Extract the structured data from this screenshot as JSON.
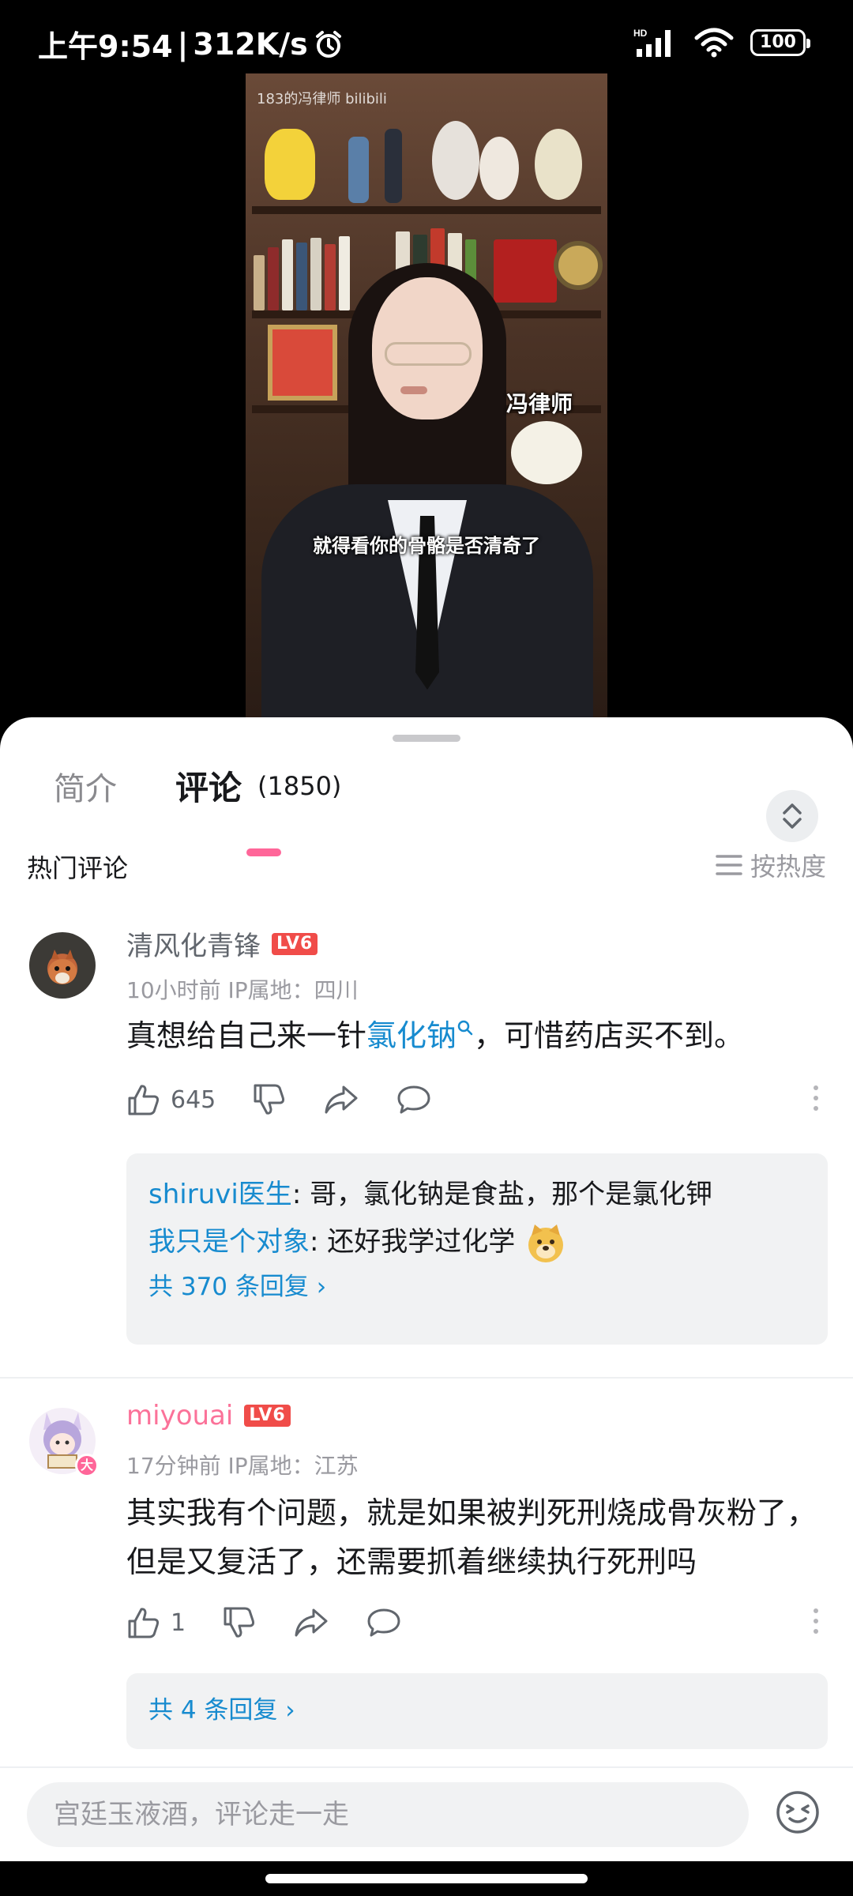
{
  "status_bar": {
    "time": "上午9:54",
    "speed": "312K/s",
    "network": "HD",
    "battery": "100"
  },
  "video": {
    "watermark": "183的冯律师 bilibili",
    "name_caption": "冯律师",
    "subtitle": "就得看你的骨骼是否清奇了"
  },
  "tabs": {
    "intro": "简介",
    "comments": "评论",
    "comments_count": "(1850)"
  },
  "section": {
    "title": "热门评论",
    "sort_label": "按热度"
  },
  "comments": [
    {
      "username": "清风化青锋",
      "level": "LV6",
      "meta": "10小时前  IP属地：四川",
      "text_before": "真想给自己来一针",
      "text_link": "氯化钠",
      "text_after": "，可惜药店买不到。",
      "likes": "645",
      "replies": [
        {
          "name": "shiruvi医生",
          "text": ": 哥，氯化钠是食盐，那个是氯化钾"
        },
        {
          "name": "我只是个对象",
          "text": ": 还好我学过化学"
        }
      ],
      "total_replies": "共 370 条回复 ›"
    },
    {
      "username": "miyouai",
      "level": "LV6",
      "avatar_badge": "大",
      "meta": "17分钟前  IP属地：江苏",
      "text": "其实我有个问题，就是如果被判死刑烧成骨灰粉了，但是又复活了，还需要抓着继续执行死刑吗",
      "likes": "1",
      "total_replies": "共 4 条回复 ›"
    }
  ],
  "input": {
    "placeholder": "宫廷玉液酒，评论走一走"
  },
  "colors": {
    "accent_pink": "#ff6699",
    "link_blue": "#178bcf",
    "level_red": "#f04c49"
  }
}
